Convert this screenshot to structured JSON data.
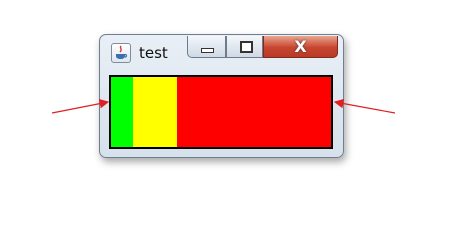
{
  "window": {
    "title": "test",
    "close_glyph": "X",
    "icons": {
      "app": "java-app-icon",
      "minimize": "minimize-icon",
      "maximize": "maximize-icon",
      "close": "close-icon"
    }
  },
  "content": {
    "segments": [
      {
        "name": "green-segment",
        "color": "#00ff00",
        "fraction": 0.1
      },
      {
        "name": "yellow-segment",
        "color": "#ffff00",
        "fraction": 0.2
      },
      {
        "name": "red-segment",
        "color": "#ff0000",
        "fraction": 0.7
      }
    ]
  },
  "annotations": {
    "arrow_color": "#e02020"
  }
}
